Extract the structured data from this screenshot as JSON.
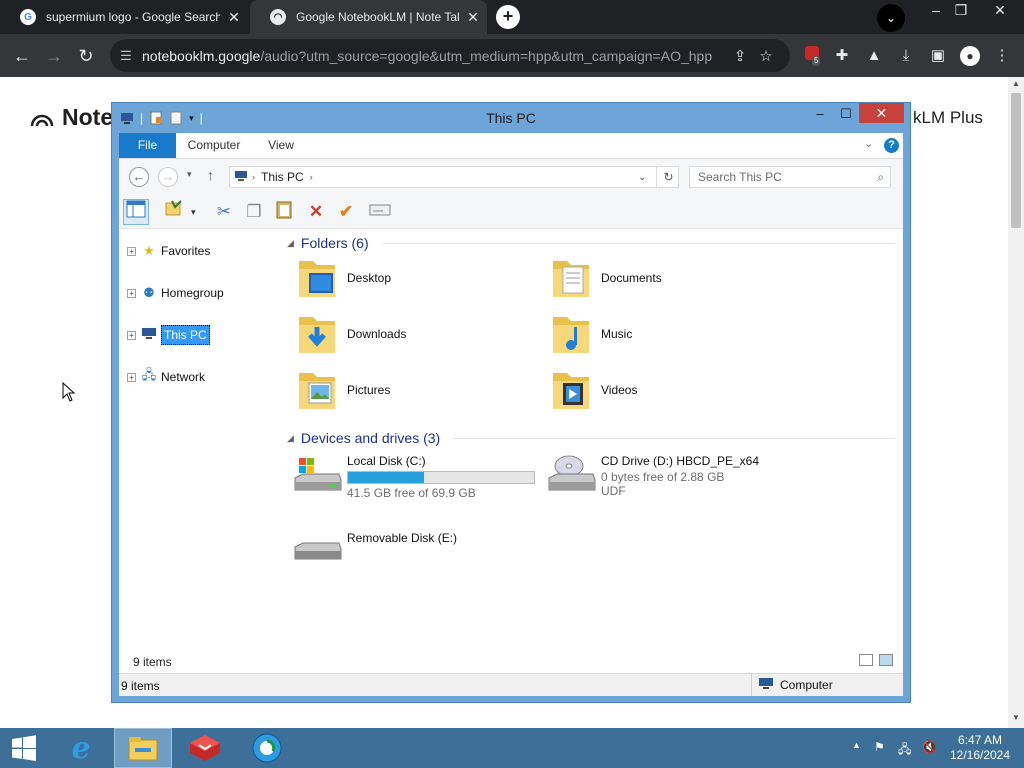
{
  "browser": {
    "tabs": [
      {
        "title": "supermium logo - Google Search",
        "favicon": "google-g-icon"
      },
      {
        "title": "Google NotebookLM | Note Taking",
        "favicon": "notebooklm-icon"
      }
    ],
    "url_host": "notebooklm.google",
    "url_path": "/audio?utm_source=google&utm_medium=hpp&utm_campaign=AO_hpp",
    "extension_badge": "5"
  },
  "page": {
    "logo_text": "Note",
    "plus_text": "kLM Plus"
  },
  "explorer": {
    "title": "This PC",
    "ribbon_tabs": [
      "File",
      "Computer",
      "View"
    ],
    "breadcrumb": "This PC",
    "search_placeholder": "Search This PC",
    "nav": [
      {
        "label": "Favorites",
        "icon": "star-icon"
      },
      {
        "label": "Homegroup",
        "icon": "homegroup-icon"
      },
      {
        "label": "This PC",
        "icon": "computer-icon"
      },
      {
        "label": "Network",
        "icon": "network-icon"
      }
    ],
    "folders_header": "Folders (6)",
    "folders": [
      {
        "name": "Desktop",
        "icon": "desktop-folder-icon"
      },
      {
        "name": "Documents",
        "icon": "documents-folder-icon"
      },
      {
        "name": "Downloads",
        "icon": "downloads-folder-icon"
      },
      {
        "name": "Music",
        "icon": "music-folder-icon"
      },
      {
        "name": "Pictures",
        "icon": "pictures-folder-icon"
      },
      {
        "name": "Videos",
        "icon": "videos-folder-icon"
      }
    ],
    "drives_header": "Devices and drives (3)",
    "drives": [
      {
        "name": "Local Disk (C:)",
        "info": "41.5 GB free of 69.9 GB",
        "used_fraction": 0.406
      },
      {
        "name": "CD Drive (D:) HBCD_PE_x64",
        "info": "0 bytes free of 2.88 GB",
        "fs": "UDF"
      },
      {
        "name": "Removable Disk (E:)"
      }
    ],
    "item_count": "9 items",
    "status_location": "Computer"
  },
  "taskbar": {
    "time": "6:47 AM",
    "date": "12/16/2024"
  }
}
